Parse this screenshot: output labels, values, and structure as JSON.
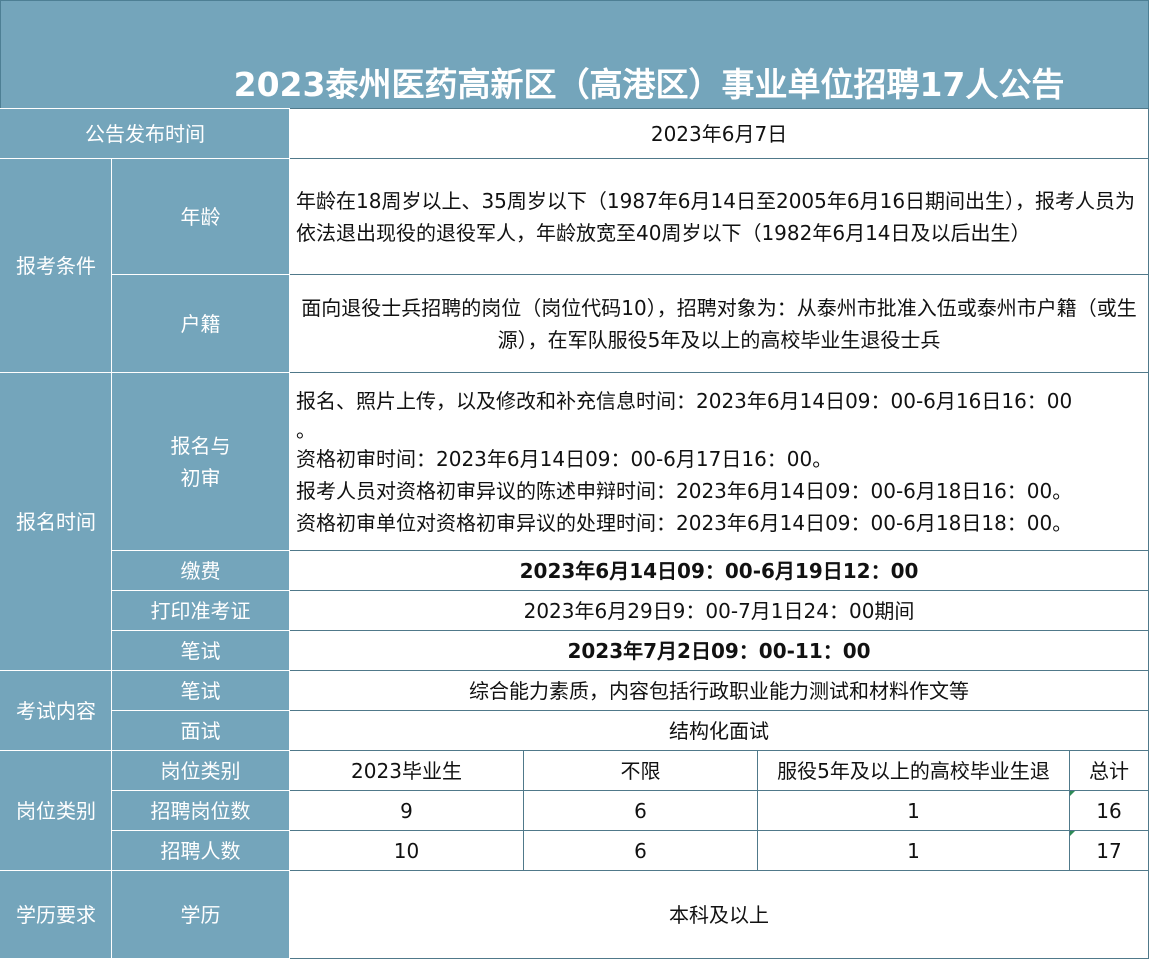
{
  "title": "2023泰州医药高新区（高港区）事业单位招聘17人公告",
  "publish": {
    "label": "公告发布时间",
    "value": "2023年6月7日"
  },
  "conditions": {
    "label": "报考条件",
    "age_label": "年龄",
    "age_text": "年龄在18周岁以上、35周岁以下（1987年6月14日至2005年6月16日期间出生），报考人员为依法退出现役的退役军人，年龄放宽至40周岁以下（1982年6月14日及以后出生）",
    "huji_label": "户籍",
    "huji_text": "面向退役士兵招聘的岗位（岗位代码10），招聘对象为：从泰州市批准入伍或泰州市户籍（或生源），在军队服役5年及以上的高校毕业生退役士兵"
  },
  "signup": {
    "label": "报名时间",
    "review_label_1": "报名与",
    "review_label_2": "初审",
    "review_lines": [
      "报名、照片上传，以及修改和补充信息时间：2023年6月14日09：00-6月16日16：00",
      "。",
      "资格初审时间：2023年6月14日09：00-6月17日16：00。",
      "报考人员对资格初审异议的陈述申辩时间：2023年6月14日09：00-6月18日16：00。",
      "资格初审单位对资格初审异议的处理时间：2023年6月14日09：00-6月18日18：00。"
    ],
    "fee_label": "缴费",
    "fee_value": "2023年6月14日09：00-6月19日12：00",
    "print_label": "打印准考证",
    "print_value": "2023年6月29日9：00-7月1日24：00期间",
    "exam_label": "笔试",
    "exam_value": "2023年7月2日09：00-11：00"
  },
  "content": {
    "label": "考试内容",
    "written_label": "笔试",
    "written_value": "综合能力素质，内容包括行政职业能力测试和材料作文等",
    "interview_label": "面试",
    "interview_value": "结构化面试"
  },
  "positions": {
    "label": "岗位类别",
    "header_label": "岗位类别",
    "columns": [
      "2023毕业生",
      "不限",
      "服役5年及以上的高校毕业生退",
      "总计"
    ],
    "count_label": "招聘岗位数",
    "counts": [
      "9",
      "6",
      "1",
      "16"
    ],
    "people_label": "招聘人数",
    "people": [
      "10",
      "6",
      "1",
      "17"
    ]
  },
  "education": {
    "label": "学历要求",
    "sub_label": "学历",
    "value": "本科及以上"
  }
}
